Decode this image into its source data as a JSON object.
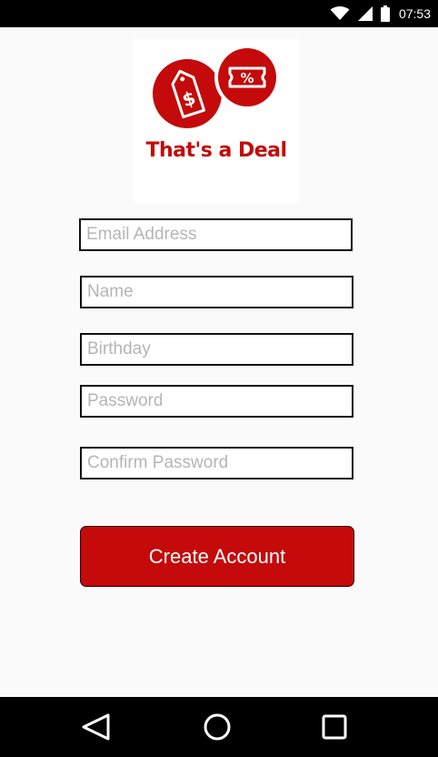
{
  "status_bar": {
    "time": "07:53",
    "icons": [
      "wifi-icon",
      "cell-signal-icon",
      "battery-icon"
    ]
  },
  "logo": {
    "title": "That's a Deal",
    "tag_symbol": "$",
    "coupon_symbol": "%",
    "brand_color": "#c40a0a"
  },
  "form": {
    "email_placeholder": "Email Address",
    "name_placeholder": "Name",
    "birthday_placeholder": "Birthday",
    "password_placeholder": "Password",
    "confirm_password_placeholder": "Confirm Password",
    "submit_label": "Create Account"
  },
  "nav_bar": {
    "buttons": [
      "back-icon",
      "home-icon",
      "recents-icon"
    ]
  }
}
